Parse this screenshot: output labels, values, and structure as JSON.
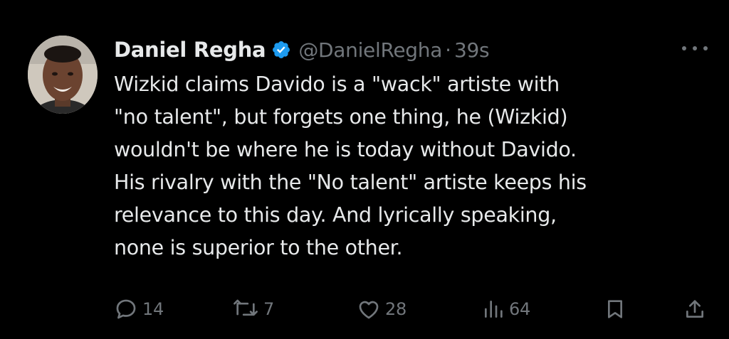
{
  "tweet": {
    "author_name": "Daniel Regha",
    "handle": "@DanielRegha",
    "separator": "·",
    "time": "39s",
    "lines": [
      "Wizkid claims Davido is a \"wack\" artiste with",
      "\"no talent\", but forgets one thing, he (Wizkid)",
      "wouldn't be where he is today without Davido.",
      "His rivalry with the \"No talent\" artiste keeps his",
      "relevance to this day. And lyrically speaking,",
      "none is superior to the other."
    ]
  },
  "actions": {
    "replies": "14",
    "reposts": "7",
    "likes": "28",
    "views": "64"
  },
  "icons": {
    "verified": "verified-badge-icon",
    "more": "more-dots-icon",
    "reply": "reply-icon",
    "repost": "repost-icon",
    "like": "heart-icon",
    "views": "views-icon",
    "bookmark": "bookmark-icon",
    "share": "share-icon"
  },
  "colors": {
    "background": "#000000",
    "text": "#e7e9ea",
    "muted": "#71767b",
    "verified_blue": "#1d9bf0"
  }
}
